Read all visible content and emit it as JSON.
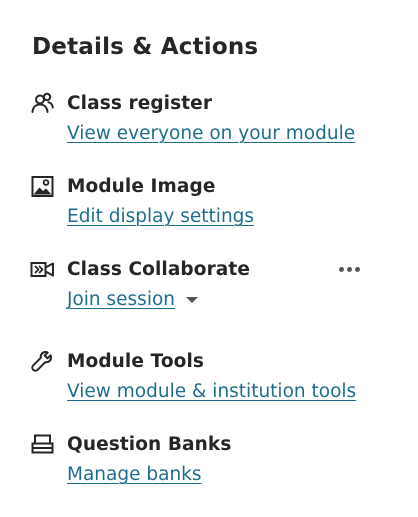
{
  "panel": {
    "title": "Details & Actions"
  },
  "items": [
    {
      "title": "Class register",
      "link": "View everyone on your module",
      "icon": "people-icon"
    },
    {
      "title": "Module Image",
      "link": "Edit display settings",
      "icon": "image-icon"
    },
    {
      "title": "Class Collaborate",
      "link": "Join session",
      "icon": "video-icon"
    },
    {
      "title": "Module Tools",
      "link": "View module & institution tools",
      "icon": "wrench-icon"
    },
    {
      "title": "Question Banks",
      "link": "Manage banks",
      "icon": "question-bank-icon"
    }
  ],
  "colors": {
    "text": "#262626",
    "link": "#1f6d8e",
    "icon": "#262626",
    "muted": "#555555"
  }
}
